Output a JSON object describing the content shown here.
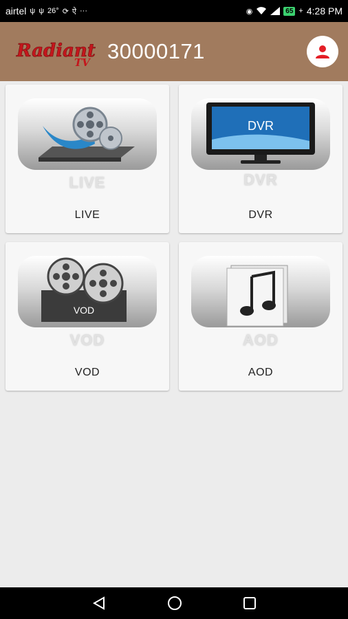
{
  "status_bar": {
    "carrier": "airtel",
    "temperature": "26°",
    "battery_level": "65",
    "time": "4:28 PM"
  },
  "header": {
    "logo_text": "Radiant TV",
    "account_number": "30000171"
  },
  "tiles": [
    {
      "label": "LIVE",
      "reflection": "LIVE"
    },
    {
      "label": "DVR",
      "reflection": "DVR",
      "screen_text": "DVR"
    },
    {
      "label": "VOD",
      "reflection": "VOD",
      "badge_text": "VOD"
    },
    {
      "label": "AOD",
      "reflection": "AOD"
    }
  ],
  "colors": {
    "header_bg": "#a17b5e",
    "profile_icon": "#e41e26",
    "page_bg": "#ececec"
  }
}
